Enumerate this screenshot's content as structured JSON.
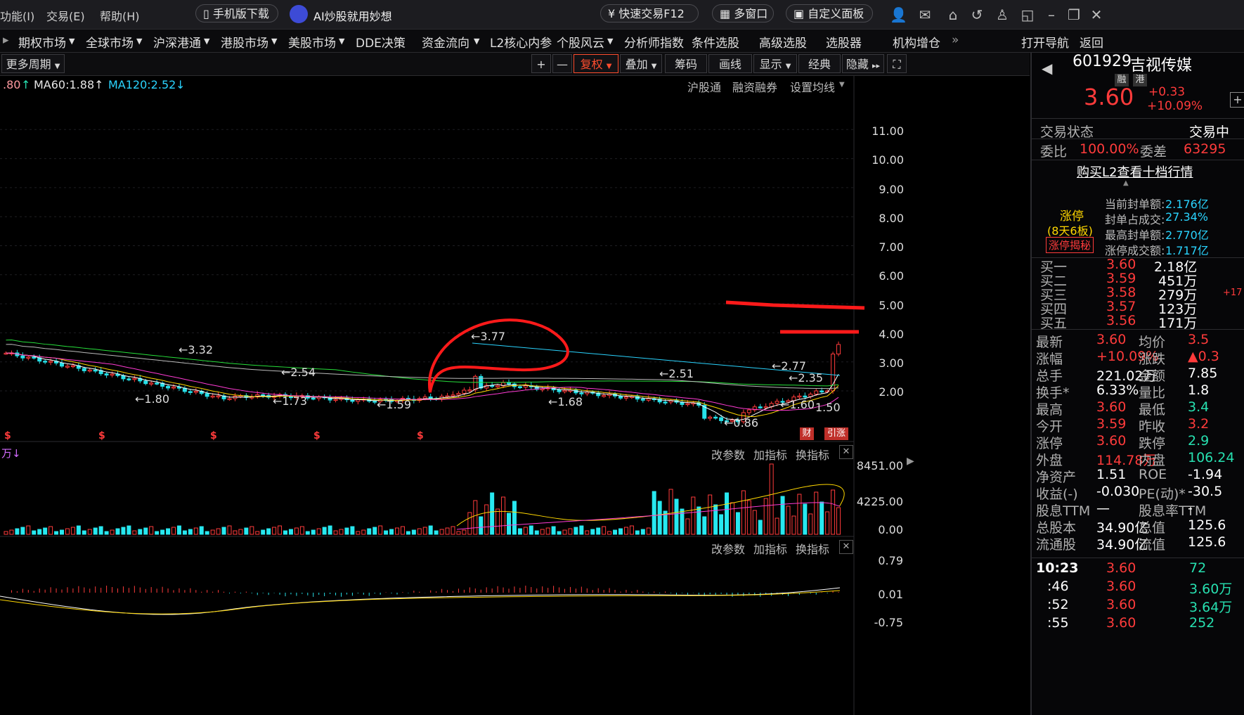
{
  "top_menu": {
    "items": [
      "功能(I)",
      "交易(E)",
      "帮助(H)"
    ]
  },
  "top_buttons": {
    "mobile": "手机版下载",
    "ai": "AI炒股就用妙想",
    "fast_trade": "快速交易F12",
    "multi_window": "多窗口",
    "custom_panel": "自定义面板"
  },
  "nav": {
    "items": [
      "期权市场",
      "全球市场",
      "沪深港通",
      "港股市场",
      "美股市场",
      "DDE决策",
      "资金流向",
      "L2核心内参",
      "个股风云",
      "分析师指数",
      "条件选股",
      "高级选股",
      "选股器",
      "机构增仓"
    ],
    "more": "»",
    "right": [
      "打开导航",
      "返回"
    ]
  },
  "toolbar": {
    "period": "更多周期",
    "plus": "+",
    "minus": "—",
    "fuquan": "复权",
    "overlay": "叠加",
    "chips": "筹码",
    "draw": "画线",
    "display": "显示",
    "classic": "经典",
    "hide": "隐藏"
  },
  "ma_legend": {
    "ma_prev": ".80",
    "ma60": "MA60:1.88",
    "ma120": "MA120:2.52",
    "links": [
      "沪股通",
      "融资融券",
      "设置均线"
    ]
  },
  "price_axis": [
    "11.00",
    "10.00",
    "9.00",
    "8.00",
    "7.00",
    "6.00",
    "5.00",
    "4.00",
    "3.00",
    "2.00"
  ],
  "price_annotations": [
    "3.32",
    "1.80",
    "2.54",
    "1.73",
    "1.59",
    "3.77",
    "1.68",
    "2.51",
    "0.86",
    "2.77",
    "2.35",
    "1.60",
    "1.50"
  ],
  "badges": {
    "fin": "财",
    "limit": "引涨"
  },
  "volume_panel": {
    "buttons": [
      "改参数",
      "加指标",
      "换指标"
    ],
    "axis": [
      "8451.00",
      "4225.00",
      "0.00"
    ]
  },
  "indicator_panel": {
    "buttons": [
      "改参数",
      "加指标",
      "换指标"
    ],
    "axis": [
      "0.79",
      "0.01",
      "-0.75"
    ]
  },
  "quote": {
    "code": "601929",
    "name": "吉视传媒",
    "tags": [
      "融",
      "港"
    ],
    "price": "3.60",
    "change": "+0.33",
    "change_pct": "+10.09%",
    "trade_status_label": "交易状态",
    "trade_status_right": "交易中",
    "weibi_label": "委比",
    "weibi": "100.00%",
    "weicha_label": "委差",
    "weicha": "63295",
    "l2_link": "购买L2查看十档行情",
    "limit_title": "涨停",
    "limit_days": "(8天6板)",
    "limit_reveal": "涨停揭秘",
    "limit_stats": [
      {
        "label": "当前封单额:",
        "value": "2.176亿"
      },
      {
        "label": "封单占成交:",
        "value": "27.34%"
      },
      {
        "label": "最高封单额:",
        "value": "2.770亿"
      },
      {
        "label": "涨停成交额:",
        "value": "1.717亿"
      }
    ],
    "bids": [
      {
        "label": "买一",
        "price": "3.60",
        "vol": "2.18亿"
      },
      {
        "label": "买二",
        "price": "3.59",
        "vol": "451万"
      },
      {
        "label": "买三",
        "price": "3.58",
        "vol": "279万",
        "extra": "+17"
      },
      {
        "label": "买四",
        "price": "3.57",
        "vol": "123万"
      },
      {
        "label": "买五",
        "price": "3.56",
        "vol": "171万"
      }
    ],
    "stats": [
      {
        "l1": "最新",
        "v1": "3.60",
        "l2": "均价",
        "v2": "3.5"
      },
      {
        "l1": "涨幅",
        "v1": "+10.09%",
        "l2": "涨跌",
        "v2": "▲0.3"
      },
      {
        "l1": "总手",
        "v1": "221.02万",
        "l2": "金额",
        "v2": "7.85"
      },
      {
        "l1": "换手*",
        "v1": "6.33%",
        "l2": "量比",
        "v2": "1.8"
      },
      {
        "l1": "最高",
        "v1": "3.60",
        "l2": "最低",
        "v2": "3.4"
      },
      {
        "l1": "今开",
        "v1": "3.59",
        "l2": "昨收",
        "v2": "3.2"
      },
      {
        "l1": "涨停",
        "v1": "3.60",
        "l2": "跌停",
        "v2": "2.9"
      },
      {
        "l1": "外盘",
        "v1": "114.78万",
        "l2": "内盘",
        "v2": "106.24"
      },
      {
        "l1": "净资产",
        "v1": "1.51",
        "l2": "ROE",
        "v2": "-1.94"
      },
      {
        "l1": "收益(-)",
        "v1": "-0.030",
        "l2": "PE(动)*",
        "v2": "-30.5"
      },
      {
        "l1": "股息TTM",
        "v1": "—",
        "l2": "股息率TTM",
        "v2": "-"
      },
      {
        "l1": "总股本",
        "v1": "34.90亿",
        "l2": "总值",
        "v2": "125.6"
      },
      {
        "l1": "流通股",
        "v1": "34.90亿",
        "l2": "流值",
        "v2": "125.6"
      }
    ],
    "ticks": [
      {
        "time": "10:23",
        "price": "3.60",
        "vol": "72"
      },
      {
        "time": ":46",
        "price": "3.60",
        "vol": "3.60万"
      },
      {
        "time": ":52",
        "price": "3.60",
        "vol": "3.64万"
      },
      {
        "time": ":55",
        "price": "3.60",
        "vol": "252"
      }
    ]
  },
  "colors": {
    "up": "#ff3b3b",
    "down": "#27e0e8",
    "accent": "#ff4d2e",
    "annotation": "#ff1a1a"
  },
  "icons": [
    "user-icon",
    "mail-icon",
    "home-icon",
    "back-icon",
    "shirt-icon",
    "window-icon",
    "minimize-icon",
    "maximize-icon",
    "close-icon"
  ]
}
